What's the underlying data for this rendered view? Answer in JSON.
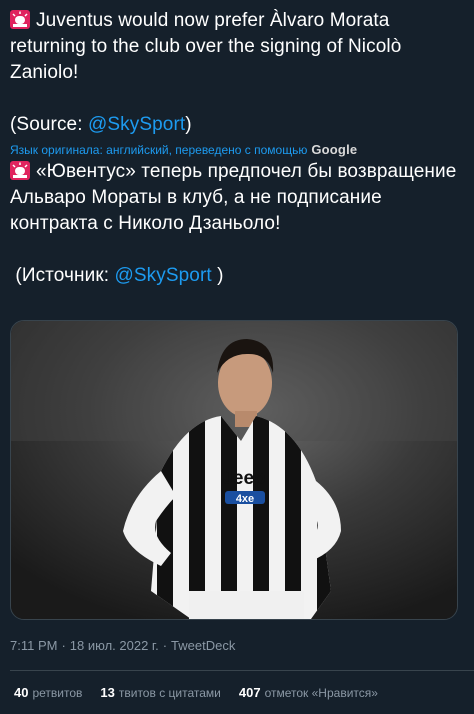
{
  "tweet": {
    "original": {
      "line1": "Juventus would now prefer Àlvaro Morata returning to the club over the signing of Nicolò Zaniolo!",
      "source_prefix": "(Source: ",
      "source_mention": "@SkySport",
      "source_suffix": ")"
    },
    "translation_note": {
      "label": "Язык оригинала: английский, переведено с помощью",
      "provider": "Google"
    },
    "translated": {
      "line1": "«Ювентус» теперь предпочел бы возвращение Альваро Мораты в клуб, а не подписание контракта с Николо Дзаньоло!",
      "source_prefix": " (Источник: ",
      "source_mention": "@SkySport",
      "source_suffix": " )"
    },
    "photo": {
      "jersey_text": "Jeep",
      "jersey_sub": "4xe"
    },
    "meta": {
      "time": "7:11 PM",
      "sep1": "·",
      "date": "18 июл. 2022 г.",
      "sep2": "·",
      "client": "TweetDeck"
    },
    "stats": {
      "retweets_count": "40",
      "retweets_label": "ретвитов",
      "quotes_count": "13",
      "quotes_label": "твитов с цитатами",
      "likes_count": "407",
      "likes_label": "отметок «Нравится»"
    }
  },
  "colors": {
    "background": "#15202b",
    "link": "#1d9bf0",
    "muted": "#8b98a5",
    "siren_red": "#e0245e"
  },
  "icons": {
    "siren": "police-car-light-emoji"
  }
}
